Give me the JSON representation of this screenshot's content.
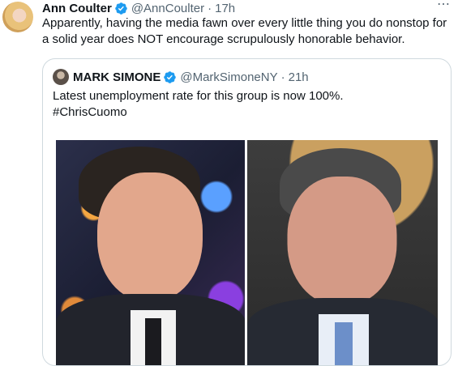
{
  "tweet": {
    "author": {
      "display_name": "Ann Coulter",
      "handle": "@AnnCoulter",
      "time": "17h",
      "verified": true
    },
    "text": "Apparently, having the media fawn over every little thing you do nonstop for a solid year does NOT encourage scrupulously honorable behavior.",
    "more_icon": "⋯"
  },
  "quoted_tweet": {
    "author": {
      "display_name": "MARK SIMONE",
      "handle": "@MarkSimoneNY",
      "time": "21h",
      "verified": true
    },
    "text": "Latest unemployment rate for this group is now 100%.",
    "hashtag": "#ChrisCuomo"
  },
  "colors": {
    "verified_blue": "#1d9bf0",
    "secondary_text": "#536471",
    "border": "#cfd9de"
  }
}
